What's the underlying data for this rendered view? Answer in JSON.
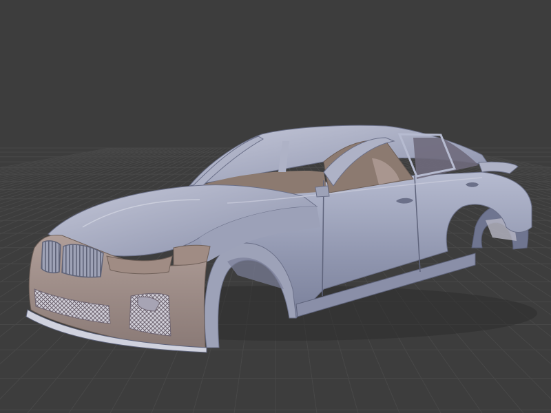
{
  "viewport": {
    "background_color": "#3d3d3d",
    "grid_color": "#484848",
    "grid_visible": true
  },
  "model": {
    "subject": "sedan-body-shell",
    "shaded_views": [
      "side",
      "front-fascia",
      "interior-shell"
    ],
    "body_color": "#8f95ae",
    "body_highlight_color": "#b6bbd0",
    "body_shadow_color": "#6f7590",
    "interior_color": "#8c7a70",
    "fascia_color": "#a9968f",
    "kidney_grille_color": "#9ea2b6",
    "mesh_color": "#6e6470"
  }
}
